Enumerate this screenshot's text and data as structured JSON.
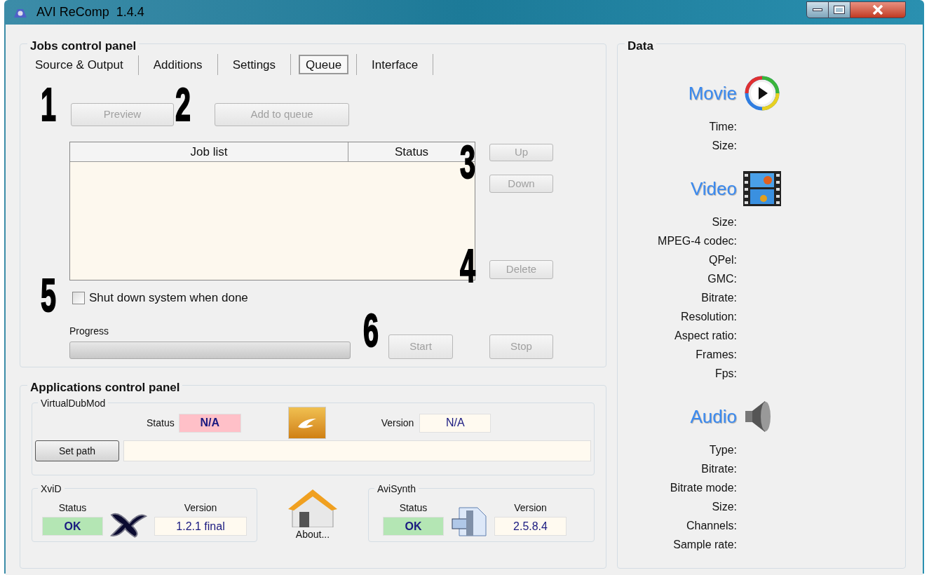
{
  "window": {
    "title": "AVI ReComp  1.4.4"
  },
  "jobs_panel": {
    "title": "Jobs control panel",
    "tabs": [
      {
        "label": "Source & Output",
        "selected": false
      },
      {
        "label": "Additions",
        "selected": false
      },
      {
        "label": "Settings",
        "selected": false
      },
      {
        "label": "Queue",
        "selected": true
      },
      {
        "label": "Interface",
        "selected": false
      }
    ],
    "top_buttons": [
      {
        "label": "Preview",
        "disabled": true
      },
      {
        "label": "Add to queue",
        "disabled": true
      }
    ],
    "job_table": {
      "columns": [
        "Job list",
        "Status"
      ]
    },
    "side_buttons": [
      {
        "label": "Up",
        "disabled": true
      },
      {
        "label": "Down",
        "disabled": true
      },
      {
        "label": "Delete",
        "disabled": true
      }
    ],
    "shutdown": {
      "label": "Shut down system when done",
      "checked": false
    },
    "progress": {
      "label": "Progress",
      "level": 0
    },
    "bottom_buttons": [
      {
        "label": "Start",
        "disabled": true
      },
      {
        "label": "Stop",
        "disabled": true
      }
    ]
  },
  "apps_panel": {
    "title": "Applications control panel",
    "virtualdubmod": {
      "title": "VirtualDubMod",
      "status_label": "Status",
      "status": {
        "text": "N/A",
        "color": "#ffc0c8"
      },
      "version_label": "Version",
      "version": "N/A",
      "set_path_button": "Set path"
    },
    "xvid": {
      "title": "XviD",
      "status_label": "Status",
      "status": {
        "text": "OK",
        "color": "#b4e6b4"
      },
      "version_label": "Version",
      "version": "1.2.1 final"
    },
    "about": {
      "label": "About..."
    },
    "avisynth": {
      "title": "AviSynth",
      "status_label": "Status",
      "status": {
        "text": "OK",
        "color": "#b4e6b4"
      },
      "version_label": "Version",
      "version": "2.5.8.4"
    }
  },
  "data_panel": {
    "title": "Data",
    "sections": [
      {
        "heading": "Movie",
        "kind": "movie",
        "fields": [
          "Time:",
          "Size:"
        ]
      },
      {
        "heading": "Video",
        "kind": "video",
        "fields": [
          "Size:",
          "MPEG-4 codec:",
          "QPel:",
          "GMC:",
          "Bitrate:",
          "Resolution:",
          "Aspect ratio:",
          "Frames:",
          "Fps:"
        ]
      },
      {
        "heading": "Audio",
        "kind": "audio",
        "fields": [
          "Type:",
          "Bitrate:",
          "Bitrate mode:",
          "Size:",
          "Channels:",
          "Sample rate:"
        ]
      }
    ]
  },
  "callouts": [
    "1",
    "2",
    "3",
    "4",
    "5",
    "6"
  ]
}
